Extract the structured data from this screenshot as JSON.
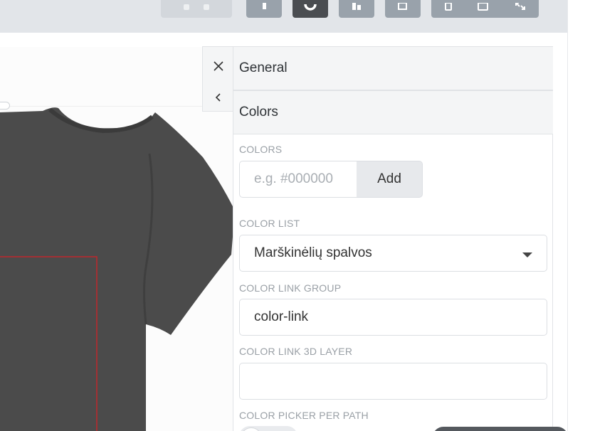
{
  "toolbar": {
    "buttons": [
      {
        "name": "undo-redo",
        "icon": "undo-redo-icon",
        "state": "disabled"
      },
      {
        "name": "text-tool",
        "icon": "text-icon",
        "state": "normal"
      },
      {
        "name": "color-tool",
        "icon": "palette-icon",
        "state": "active"
      },
      {
        "name": "layers-tool",
        "icon": "layers-icon",
        "state": "normal"
      },
      {
        "name": "crop-tool",
        "icon": "crop-icon",
        "state": "normal"
      },
      {
        "name": "device-preview",
        "icons": [
          "mobile-icon",
          "tablet-icon",
          "fullscreen-icon"
        ],
        "state": "normal"
      }
    ]
  },
  "panel": {
    "side_icons": [
      "close-icon",
      "chevron-left-icon"
    ],
    "general_title": "General",
    "colors_title": "Colors",
    "colors_label": "COLORS",
    "colors_placeholder": "e.g. #000000",
    "add_label": "Add",
    "color_list_label": "COLOR LIST",
    "color_list_value": "Marškinėlių spalvos",
    "color_link_group_label": "COLOR LINK GROUP",
    "color_link_group_value": "color-link",
    "color_link_3d_label": "COLOR LINK 3D LAYER",
    "color_link_3d_value": "",
    "color_picker_per_path_label": "COLOR PICKER PER PATH"
  },
  "colors": {
    "toolbar_bg": "#e2e5e9",
    "button": "#99a2ab",
    "button_active": "#4a4d51",
    "shirt": "#4b4b4b",
    "print_area": "#c0272d"
  }
}
